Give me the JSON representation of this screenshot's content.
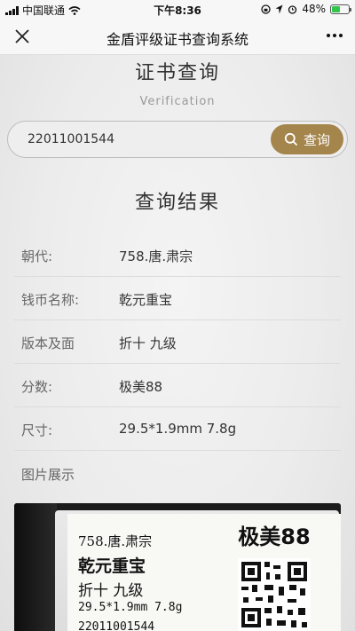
{
  "status_bar": {
    "carrier": "中国联通",
    "time": "下午8:36",
    "battery": "48%",
    "battery_level": 0.48
  },
  "nav": {
    "title": "金盾评级证书查询系统",
    "close_icon": "close-icon",
    "more_icon": "more-icon"
  },
  "page": {
    "heading": "证书查询",
    "subheading": "Verification"
  },
  "search": {
    "value": "22011001544",
    "button_label": "查询",
    "button_icon": "search-icon",
    "accent_color": "#a4854c"
  },
  "result": {
    "heading": "查询结果",
    "rows": [
      {
        "label": "朝代:",
        "value": "758.唐.肃宗"
      },
      {
        "label": "钱币名称:",
        "value": "乾元重宝"
      },
      {
        "label": "版本及面",
        "value": "折十 九级"
      },
      {
        "label": "分数:",
        "value": "极美88"
      },
      {
        "label": "尺寸:",
        "value": "29.5*1.9mm 7.8g"
      }
    ],
    "image_label": "图片展示"
  },
  "slab": {
    "line1": "758.唐.肃宗",
    "line2": "乾元重宝",
    "line3": "折十 九级",
    "line4": "29.5*1.9mm 7.8g",
    "line5": "22011001544",
    "grade": "极美88"
  }
}
